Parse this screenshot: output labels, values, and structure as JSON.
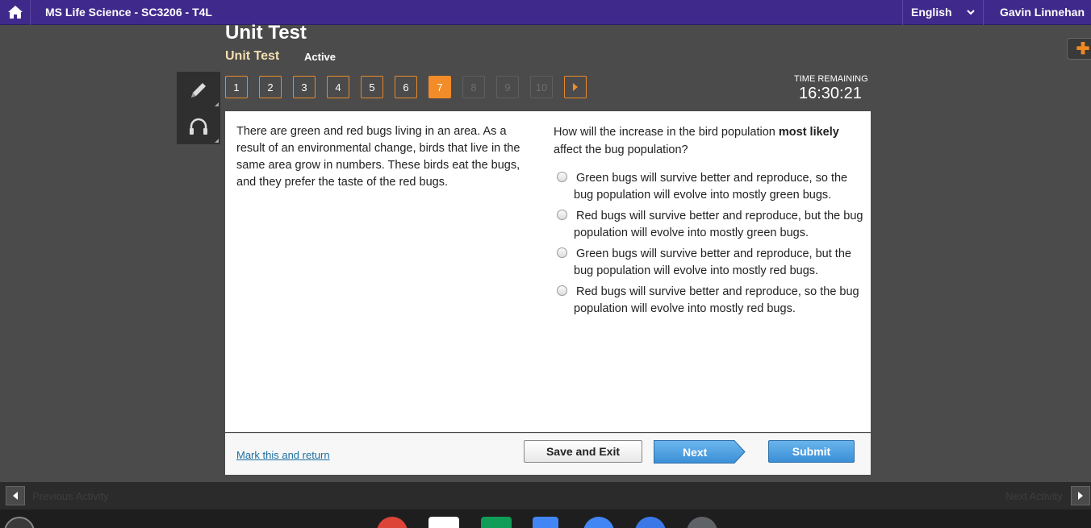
{
  "topbar": {
    "title": "MS Life Science - SC3206 - T4L",
    "language": "English",
    "user": "Gavin Linnehan"
  },
  "header": {
    "title": "Unit Test",
    "subtitle": "Unit Test",
    "status": "Active"
  },
  "question_nav": {
    "items": [
      {
        "label": "1",
        "state": "available"
      },
      {
        "label": "2",
        "state": "available"
      },
      {
        "label": "3",
        "state": "available"
      },
      {
        "label": "4",
        "state": "available"
      },
      {
        "label": "5",
        "state": "available"
      },
      {
        "label": "6",
        "state": "available"
      },
      {
        "label": "7",
        "state": "active"
      },
      {
        "label": "8",
        "state": "disabled"
      },
      {
        "label": "9",
        "state": "disabled"
      },
      {
        "label": "10",
        "state": "disabled"
      }
    ]
  },
  "timer": {
    "label": "TIME REMAINING",
    "value": "16:30:21"
  },
  "passage": "There are green and red bugs living in an area. As a result of an environmental change, birds that live in the same area grow in numbers. These birds eat the bugs, and they prefer the taste of the red bugs.",
  "question": {
    "prefix": "How will the increase in the bird population ",
    "emphasis": "most likely",
    "suffix": " affect the bug population?"
  },
  "choices": [
    "Green bugs will survive better and reproduce, so the bug population will evolve into mostly green bugs.",
    "Red bugs will survive better and reproduce, but the bug population will evolve into mostly green bugs.",
    "Green bugs will survive better and reproduce, but the bug population will evolve into mostly red bugs.",
    "Red bugs will survive better and reproduce, so the bug population will evolve into mostly red bugs."
  ],
  "footer": {
    "mark_label": "Mark this and return",
    "save_label": "Save and Exit",
    "next_label": "Next",
    "submit_label": "Submit"
  },
  "activity_bar": {
    "prev_label": "Previous Activity",
    "next_label": "Next Activity"
  },
  "colors": {
    "topbar": "#3f2a8c",
    "accent_orange": "#f28c28",
    "button_blue": "#3b8fd6"
  }
}
